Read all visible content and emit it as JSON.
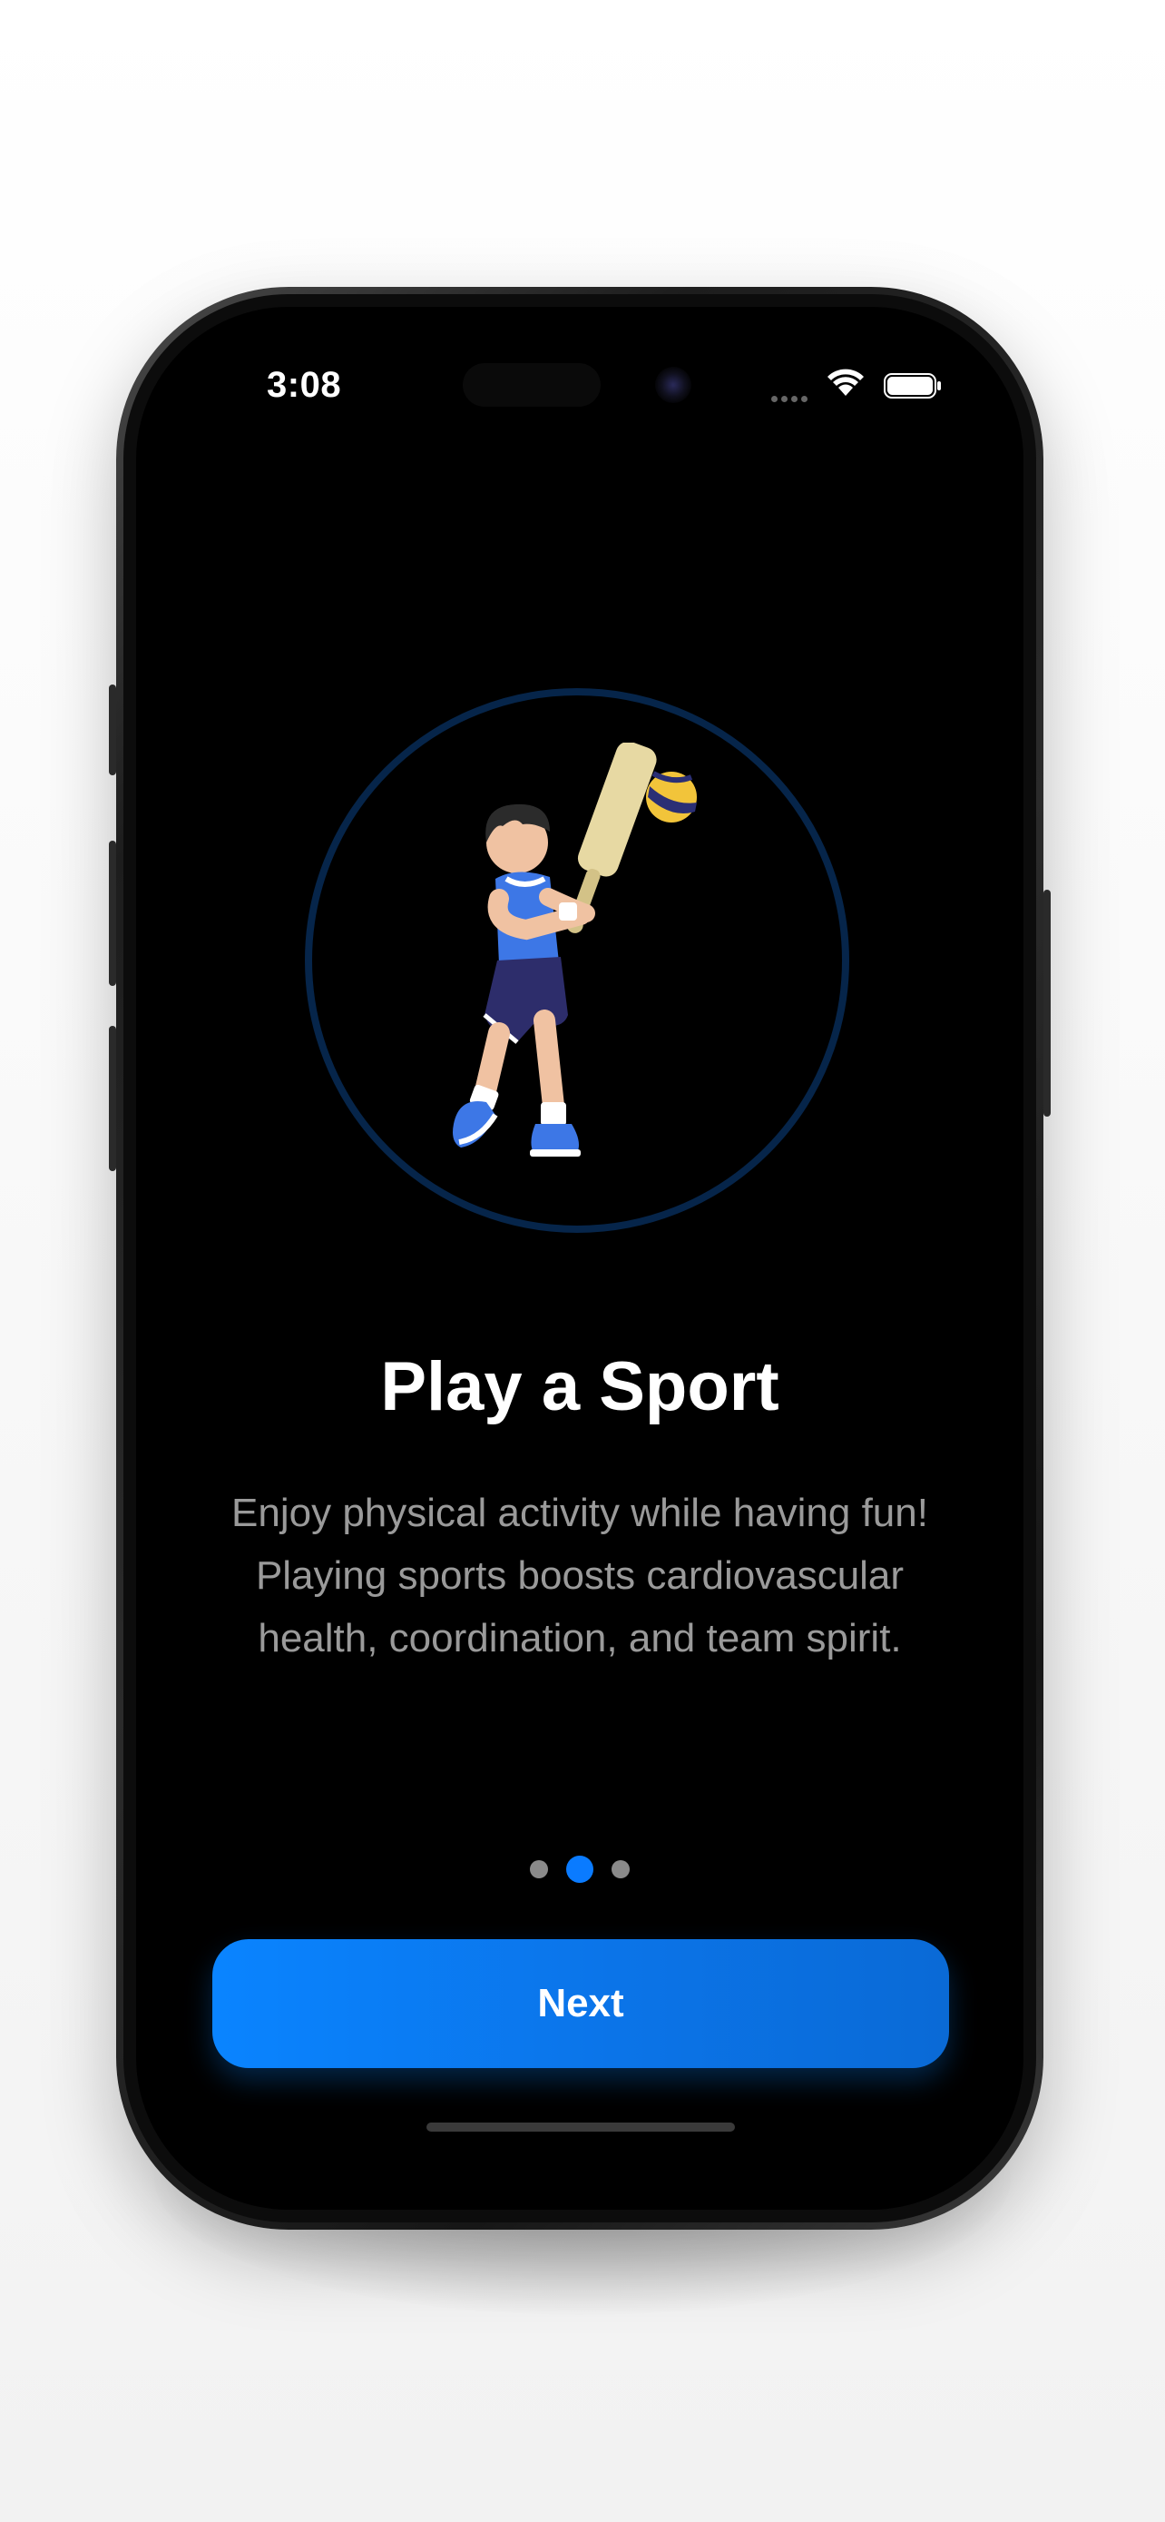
{
  "status_bar": {
    "time": "3:08"
  },
  "onboarding": {
    "title": "Play a Sport",
    "description": "Enjoy physical activity while having fun! Playing sports boosts cardiovascular health, coordination, and team spirit.",
    "page_indicator": {
      "total": 3,
      "current": 2
    },
    "next_label": "Next"
  },
  "colors": {
    "accent": "#0A84FF",
    "ring": "#06254A",
    "background": "#000000",
    "secondary_text": "#9A9A9A"
  }
}
